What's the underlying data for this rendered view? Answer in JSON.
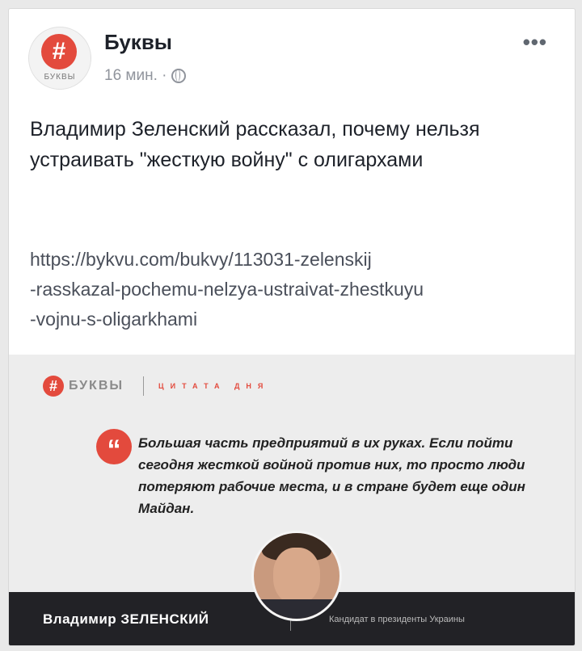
{
  "post": {
    "page_name": "Буквы",
    "avatar_label": "БУКВЫ",
    "avatar_symbol": "#",
    "time": "16 мин. ·",
    "more": "•••",
    "text": "Владимир Зеленский рассказал, почему нельзя устраивать \"жесткую войну\" с олигархами",
    "link_lines": [
      "https://bykvu.com/bukvy/113031-zelenskij",
      "-rasskazal-pochemu-nelzya-ustraivat-zhestkuyu",
      "-vojnu-s-oligarkhami"
    ]
  },
  "image": {
    "brand_symbol": "#",
    "brand_name": "БУКВЫ",
    "tagline": "ЦИТАТА ДНЯ",
    "quote_symbol": "“",
    "quote": "Большая часть предприятий в их руках. Если пойти сегодня жесткой войной против них, то просто люди потеряют рабочие места, и в стране будет еще один Майдан.",
    "speaker": "Владимир ЗЕЛЕНСКИЙ",
    "role": "Кандидат в президенты Украины"
  },
  "colors": {
    "accent": "#e34a3d",
    "bar": "#222226"
  }
}
